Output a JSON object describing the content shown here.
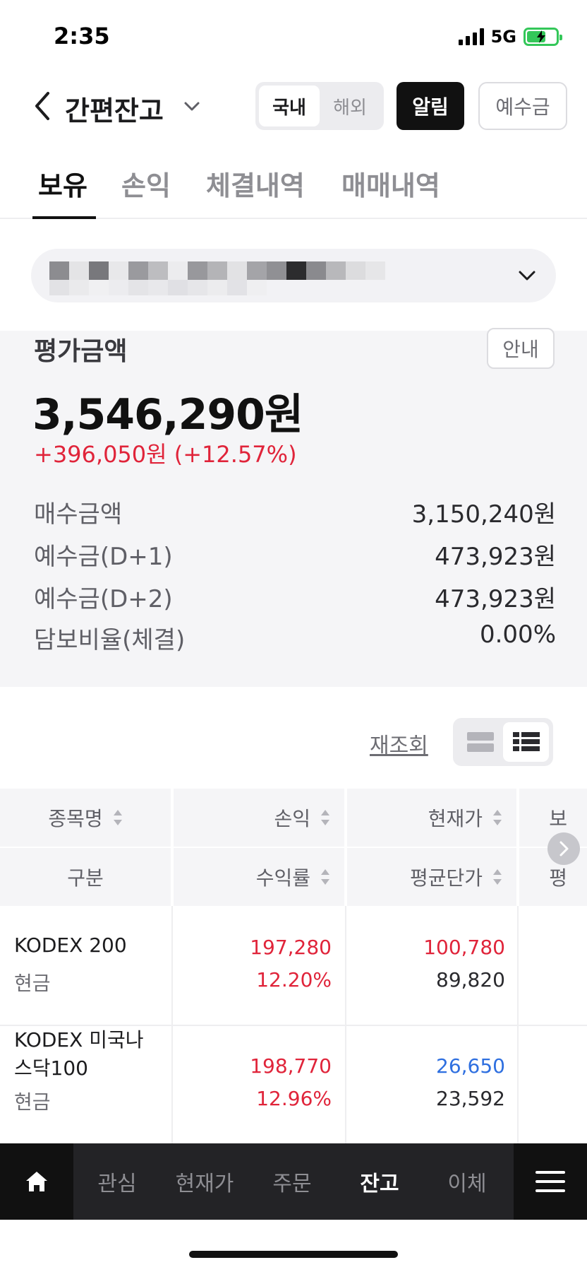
{
  "status_bar": {
    "time": "2:35",
    "network": "5G"
  },
  "header": {
    "back_icon": "chevron-left-icon",
    "title": "간편잔고",
    "title_dropdown_icon": "chevron-down-icon",
    "segment": {
      "options": [
        "국내",
        "해외"
      ],
      "selected": "국내"
    },
    "alarm_label": "알림",
    "deposit_label": "예수금"
  },
  "tabs": [
    {
      "label": "보유",
      "active": true
    },
    {
      "label": "손익",
      "active": false
    },
    {
      "label": "체결내역",
      "active": false
    },
    {
      "label": "매매내역",
      "active": false
    }
  ],
  "summary": {
    "label": "평가금액",
    "guide_label": "안내",
    "total": "3,546,290원",
    "profit_line": "+396,050원 (+12.57%)",
    "rows": [
      {
        "key": "매수금액",
        "value": "3,150,240원"
      },
      {
        "key": "예수금(D+1)",
        "value": "473,923원"
      },
      {
        "key": "예수금(D+2)",
        "value": "473,923원"
      },
      {
        "key": "담보비율(체결)",
        "value": "0.00%"
      }
    ]
  },
  "controls": {
    "refresh_label": "재조회"
  },
  "table": {
    "headers_top": [
      "종목명",
      "손익",
      "현재가",
      "보"
    ],
    "headers_bottom": [
      "구분",
      "수익률",
      "평균단가",
      "평"
    ],
    "rows": [
      {
        "name": "KODEX 200",
        "type": "현금",
        "pl": "197,280",
        "rate": "12.20%",
        "price": "100,780",
        "avg": "89,820"
      },
      {
        "name": "KODEX 미국나스닥100",
        "name_line1": "KODEX 미국나",
        "name_line2": "스닥100",
        "type": "현금",
        "pl": "198,770",
        "rate": "12.96%",
        "price": "26,650",
        "avg": "23,592"
      }
    ]
  },
  "bottom_nav": {
    "home_icon": "home-icon",
    "items": [
      "관심",
      "현재가",
      "주문",
      "잔고",
      "이체"
    ],
    "active": "잔고",
    "menu_icon": "menu-icon"
  },
  "colors": {
    "up": "#e0243a",
    "down": "#2e6fe0",
    "battery": "#34c759"
  }
}
